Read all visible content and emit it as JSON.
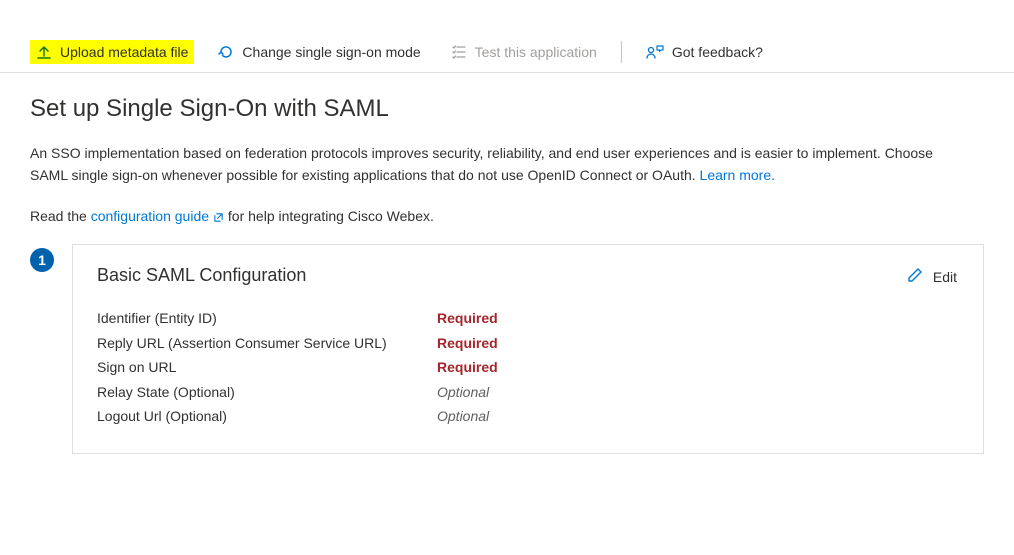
{
  "toolbar": {
    "upload_label": "Upload metadata file",
    "change_mode_label": "Change single sign-on mode",
    "test_app_label": "Test this application",
    "feedback_label": "Got feedback?"
  },
  "page": {
    "title": "Set up Single Sign-On with SAML",
    "description_pre": "An SSO implementation based on federation protocols improves security, reliability, and end user experiences and is easier to implement. Choose SAML single sign-on whenever possible for existing applications that do not use OpenID Connect or OAuth. ",
    "learn_more": "Learn more.",
    "subtext_pre": "Read the ",
    "config_guide": "configuration guide",
    "subtext_post": " for help integrating Cisco Webex."
  },
  "step": {
    "number": "1",
    "card_title": "Basic SAML Configuration",
    "edit_label": "Edit",
    "fields": [
      {
        "label": "Identifier (Entity ID)",
        "value": "Required",
        "kind": "required"
      },
      {
        "label": "Reply URL (Assertion Consumer Service URL)",
        "value": "Required",
        "kind": "required"
      },
      {
        "label": "Sign on URL",
        "value": "Required",
        "kind": "required"
      },
      {
        "label": "Relay State (Optional)",
        "value": "Optional",
        "kind": "optional"
      },
      {
        "label": "Logout Url (Optional)",
        "value": "Optional",
        "kind": "optional"
      }
    ]
  }
}
